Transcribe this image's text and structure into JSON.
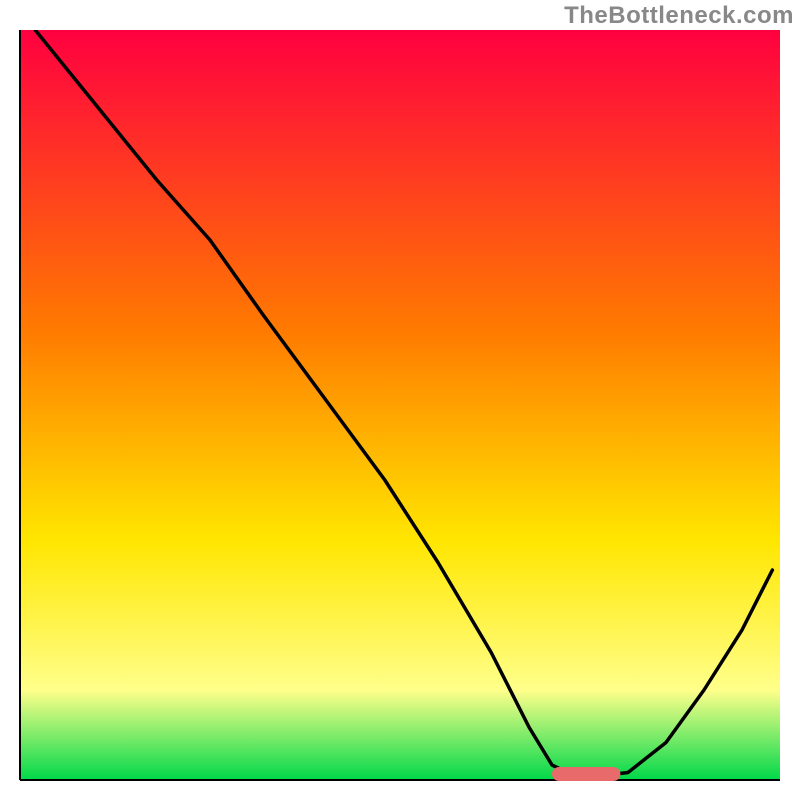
{
  "watermark": "TheBottleneck.com",
  "colors": {
    "gradient_top": "#ff0040",
    "gradient_mid1": "#ff7a00",
    "gradient_mid2": "#ffe600",
    "gradient_mid3": "#ffff8a",
    "gradient_bottom": "#00d84a",
    "curve": "#000000",
    "marker": "#e86a6a",
    "axis": "#000000",
    "background": "#ffffff"
  },
  "chart_data": {
    "type": "line",
    "title": "",
    "xlabel": "",
    "ylabel": "",
    "xlim": [
      0,
      100
    ],
    "ylim": [
      0,
      100
    ],
    "x": [
      2,
      10,
      18,
      25,
      32,
      40,
      48,
      55,
      62,
      67,
      70,
      73,
      76,
      80,
      85,
      90,
      95,
      99
    ],
    "values": [
      100,
      90,
      80,
      72,
      62,
      51,
      40,
      29,
      17,
      7,
      2,
      0.5,
      0.5,
      1,
      5,
      12,
      20,
      28
    ],
    "optimum_marker": {
      "x_start": 70,
      "x_end": 79,
      "y": 0.8
    },
    "annotations": []
  }
}
